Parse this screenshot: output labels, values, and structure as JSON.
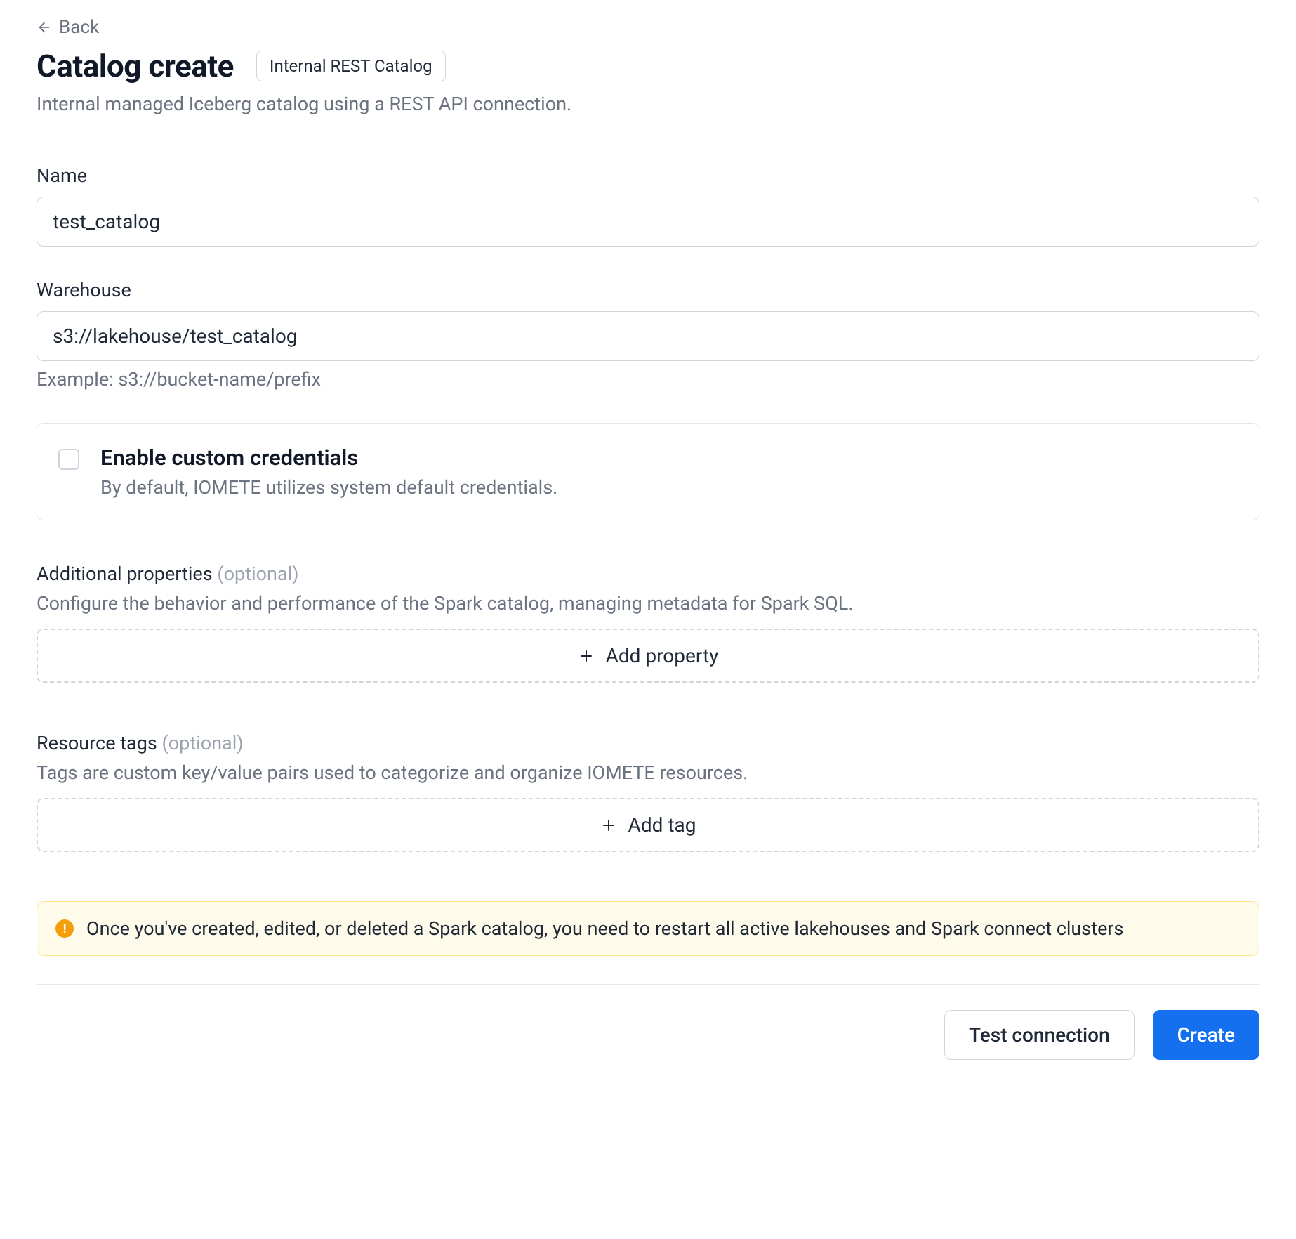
{
  "header": {
    "back_label": "Back",
    "title": "Catalog create",
    "badge": "Internal REST Catalog",
    "subtitle": "Internal managed Iceberg catalog using a REST API connection."
  },
  "form": {
    "name": {
      "label": "Name",
      "value": "test_catalog"
    },
    "warehouse": {
      "label": "Warehouse",
      "value": "s3://lakehouse/test_catalog",
      "help": "Example: s3://bucket-name/prefix"
    },
    "credentials": {
      "title": "Enable custom credentials",
      "description": "By default, IOMETE utilizes system default credentials."
    },
    "additional_properties": {
      "label": "Additional properties",
      "optional": "(optional)",
      "description": "Configure the behavior and performance of the Spark catalog, managing metadata for Spark SQL.",
      "button": "Add property"
    },
    "resource_tags": {
      "label": "Resource tags",
      "optional": "(optional)",
      "description": "Tags are custom key/value pairs used to categorize and organize IOMETE resources.",
      "button": "Add tag"
    }
  },
  "alert": {
    "text": "Once you've created, edited, or deleted a Spark catalog, you need to restart all active lakehouses and Spark connect clusters"
  },
  "footer": {
    "test_connection": "Test connection",
    "create": "Create"
  }
}
